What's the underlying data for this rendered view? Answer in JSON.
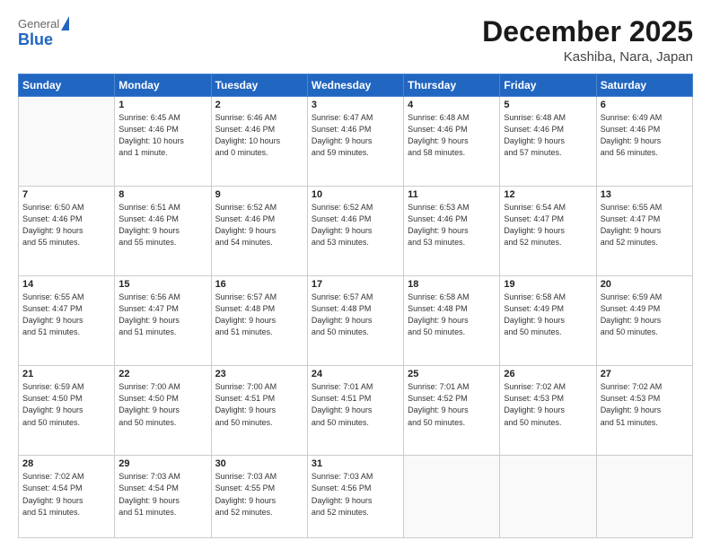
{
  "header": {
    "logo_general": "General",
    "logo_blue": "Blue",
    "title": "December 2025",
    "location": "Kashiba, Nara, Japan"
  },
  "days_of_week": [
    "Sunday",
    "Monday",
    "Tuesday",
    "Wednesday",
    "Thursday",
    "Friday",
    "Saturday"
  ],
  "weeks": [
    [
      {
        "day": "",
        "info": ""
      },
      {
        "day": "1",
        "info": "Sunrise: 6:45 AM\nSunset: 4:46 PM\nDaylight: 10 hours\nand 1 minute."
      },
      {
        "day": "2",
        "info": "Sunrise: 6:46 AM\nSunset: 4:46 PM\nDaylight: 10 hours\nand 0 minutes."
      },
      {
        "day": "3",
        "info": "Sunrise: 6:47 AM\nSunset: 4:46 PM\nDaylight: 9 hours\nand 59 minutes."
      },
      {
        "day": "4",
        "info": "Sunrise: 6:48 AM\nSunset: 4:46 PM\nDaylight: 9 hours\nand 58 minutes."
      },
      {
        "day": "5",
        "info": "Sunrise: 6:48 AM\nSunset: 4:46 PM\nDaylight: 9 hours\nand 57 minutes."
      },
      {
        "day": "6",
        "info": "Sunrise: 6:49 AM\nSunset: 4:46 PM\nDaylight: 9 hours\nand 56 minutes."
      }
    ],
    [
      {
        "day": "7",
        "info": "Sunrise: 6:50 AM\nSunset: 4:46 PM\nDaylight: 9 hours\nand 55 minutes."
      },
      {
        "day": "8",
        "info": "Sunrise: 6:51 AM\nSunset: 4:46 PM\nDaylight: 9 hours\nand 55 minutes."
      },
      {
        "day": "9",
        "info": "Sunrise: 6:52 AM\nSunset: 4:46 PM\nDaylight: 9 hours\nand 54 minutes."
      },
      {
        "day": "10",
        "info": "Sunrise: 6:52 AM\nSunset: 4:46 PM\nDaylight: 9 hours\nand 53 minutes."
      },
      {
        "day": "11",
        "info": "Sunrise: 6:53 AM\nSunset: 4:46 PM\nDaylight: 9 hours\nand 53 minutes."
      },
      {
        "day": "12",
        "info": "Sunrise: 6:54 AM\nSunset: 4:47 PM\nDaylight: 9 hours\nand 52 minutes."
      },
      {
        "day": "13",
        "info": "Sunrise: 6:55 AM\nSunset: 4:47 PM\nDaylight: 9 hours\nand 52 minutes."
      }
    ],
    [
      {
        "day": "14",
        "info": "Sunrise: 6:55 AM\nSunset: 4:47 PM\nDaylight: 9 hours\nand 51 minutes."
      },
      {
        "day": "15",
        "info": "Sunrise: 6:56 AM\nSunset: 4:47 PM\nDaylight: 9 hours\nand 51 minutes."
      },
      {
        "day": "16",
        "info": "Sunrise: 6:57 AM\nSunset: 4:48 PM\nDaylight: 9 hours\nand 51 minutes."
      },
      {
        "day": "17",
        "info": "Sunrise: 6:57 AM\nSunset: 4:48 PM\nDaylight: 9 hours\nand 50 minutes."
      },
      {
        "day": "18",
        "info": "Sunrise: 6:58 AM\nSunset: 4:48 PM\nDaylight: 9 hours\nand 50 minutes."
      },
      {
        "day": "19",
        "info": "Sunrise: 6:58 AM\nSunset: 4:49 PM\nDaylight: 9 hours\nand 50 minutes."
      },
      {
        "day": "20",
        "info": "Sunrise: 6:59 AM\nSunset: 4:49 PM\nDaylight: 9 hours\nand 50 minutes."
      }
    ],
    [
      {
        "day": "21",
        "info": "Sunrise: 6:59 AM\nSunset: 4:50 PM\nDaylight: 9 hours\nand 50 minutes."
      },
      {
        "day": "22",
        "info": "Sunrise: 7:00 AM\nSunset: 4:50 PM\nDaylight: 9 hours\nand 50 minutes."
      },
      {
        "day": "23",
        "info": "Sunrise: 7:00 AM\nSunset: 4:51 PM\nDaylight: 9 hours\nand 50 minutes."
      },
      {
        "day": "24",
        "info": "Sunrise: 7:01 AM\nSunset: 4:51 PM\nDaylight: 9 hours\nand 50 minutes."
      },
      {
        "day": "25",
        "info": "Sunrise: 7:01 AM\nSunset: 4:52 PM\nDaylight: 9 hours\nand 50 minutes."
      },
      {
        "day": "26",
        "info": "Sunrise: 7:02 AM\nSunset: 4:53 PM\nDaylight: 9 hours\nand 50 minutes."
      },
      {
        "day": "27",
        "info": "Sunrise: 7:02 AM\nSunset: 4:53 PM\nDaylight: 9 hours\nand 51 minutes."
      }
    ],
    [
      {
        "day": "28",
        "info": "Sunrise: 7:02 AM\nSunset: 4:54 PM\nDaylight: 9 hours\nand 51 minutes."
      },
      {
        "day": "29",
        "info": "Sunrise: 7:03 AM\nSunset: 4:54 PM\nDaylight: 9 hours\nand 51 minutes."
      },
      {
        "day": "30",
        "info": "Sunrise: 7:03 AM\nSunset: 4:55 PM\nDaylight: 9 hours\nand 52 minutes."
      },
      {
        "day": "31",
        "info": "Sunrise: 7:03 AM\nSunset: 4:56 PM\nDaylight: 9 hours\nand 52 minutes."
      },
      {
        "day": "",
        "info": ""
      },
      {
        "day": "",
        "info": ""
      },
      {
        "day": "",
        "info": ""
      }
    ]
  ]
}
